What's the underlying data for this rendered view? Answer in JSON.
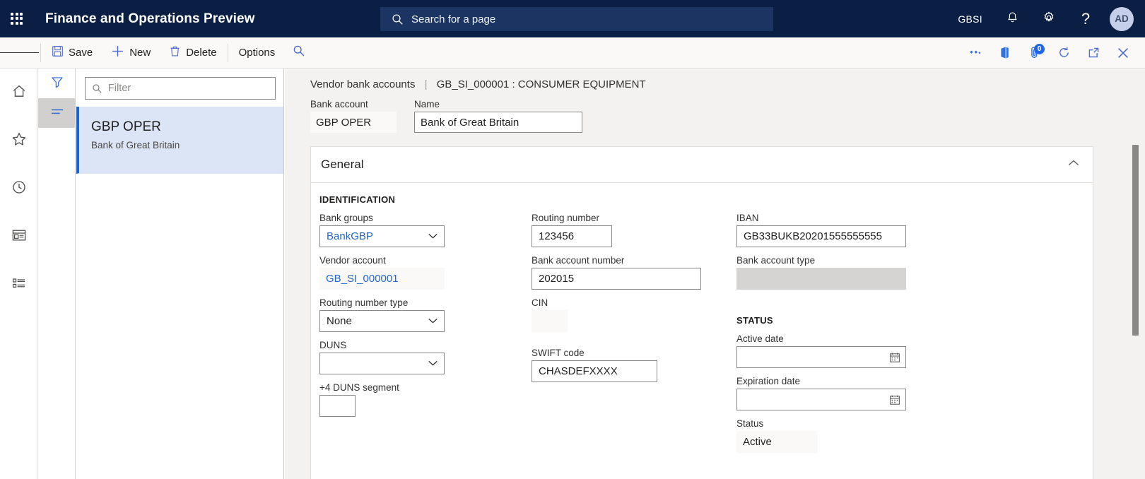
{
  "topbar": {
    "waffle_icon": "app-launcher-icon",
    "app_title": "Finance and Operations Preview",
    "search_placeholder": "Search for a page",
    "search_icon": "search-icon",
    "company": "GBSI",
    "notifications_icon": "bell-icon",
    "settings_icon": "gear-icon",
    "help_icon": "question-mark-icon",
    "avatar_initials": "AD"
  },
  "commandbar": {
    "menu_icon": "hamburger-icon",
    "save_label": "Save",
    "save_icon": "save-floppy-icon",
    "new_label": "New",
    "new_icon": "plus-icon",
    "delete_label": "Delete",
    "delete_icon": "trash-icon",
    "options_label": "Options",
    "search_icon": "search-icon",
    "right_icons": [
      {
        "name": "relations-icon"
      },
      {
        "name": "office-export-icon"
      },
      {
        "name": "attachment-icon",
        "badge": "0"
      },
      {
        "name": "refresh-icon"
      },
      {
        "name": "open-in-new-window-icon"
      },
      {
        "name": "close-icon"
      }
    ]
  },
  "leftrail": {
    "items": [
      {
        "name": "home-icon"
      },
      {
        "name": "favorites-star-icon"
      },
      {
        "name": "recent-clock-icon"
      },
      {
        "name": "workspaces-icon"
      },
      {
        "name": "modules-list-icon"
      }
    ]
  },
  "filterstrip": {
    "filter_icon": "funnel-filter-icon",
    "list_icon": "list-lines-icon"
  },
  "listpanel": {
    "filter_placeholder": "Filter",
    "filter_icon": "search-icon",
    "items": [
      {
        "title": "GBP OPER",
        "subtitle": "Bank of Great Britain",
        "selected": true
      }
    ]
  },
  "breadcrumb": {
    "page": "Vendor bank accounts",
    "separator": "|",
    "record": "GB_SI_000001 : CONSUMER EQUIPMENT"
  },
  "header_fields": {
    "bank_account_label": "Bank account",
    "bank_account_value": "GBP OPER",
    "name_label": "Name",
    "name_value": "Bank of Great Britain"
  },
  "general": {
    "title": "General",
    "collapse_icon": "chevron-up-icon",
    "identification_heading": "IDENTIFICATION",
    "status_heading": "STATUS",
    "fields": {
      "bank_groups_label": "Bank groups",
      "bank_groups_value": "BankGBP",
      "vendor_account_label": "Vendor account",
      "vendor_account_value": "GB_SI_000001",
      "routing_number_type_label": "Routing number type",
      "routing_number_type_value": "None",
      "duns_label": "DUNS",
      "duns_value": "",
      "duns_segment_label": "+4 DUNS segment",
      "duns_segment_value": "",
      "routing_number_label": "Routing number",
      "routing_number_value": "123456",
      "bank_account_number_label": "Bank account number",
      "bank_account_number_value": "202015",
      "cin_label": "CIN",
      "cin_value": "",
      "swift_code_label": "SWIFT code",
      "swift_code_value": "CHASDEFXXXX",
      "iban_label": "IBAN",
      "iban_value": "GB33BUKB20201555555555",
      "bank_account_type_label": "Bank account type",
      "bank_account_type_value": "",
      "active_date_label": "Active date",
      "active_date_value": "",
      "expiration_date_label": "Expiration date",
      "expiration_date_value": "",
      "status_label": "Status",
      "status_value": "Active",
      "calendar_icon": "calendar-icon",
      "chevron_icon": "chevron-down-icon"
    }
  },
  "colors": {
    "brand_navy": "#0b1f44",
    "accent_blue": "#2266e3",
    "selected_row": "#dce5f5",
    "canvas": "#f3f2f1"
  }
}
